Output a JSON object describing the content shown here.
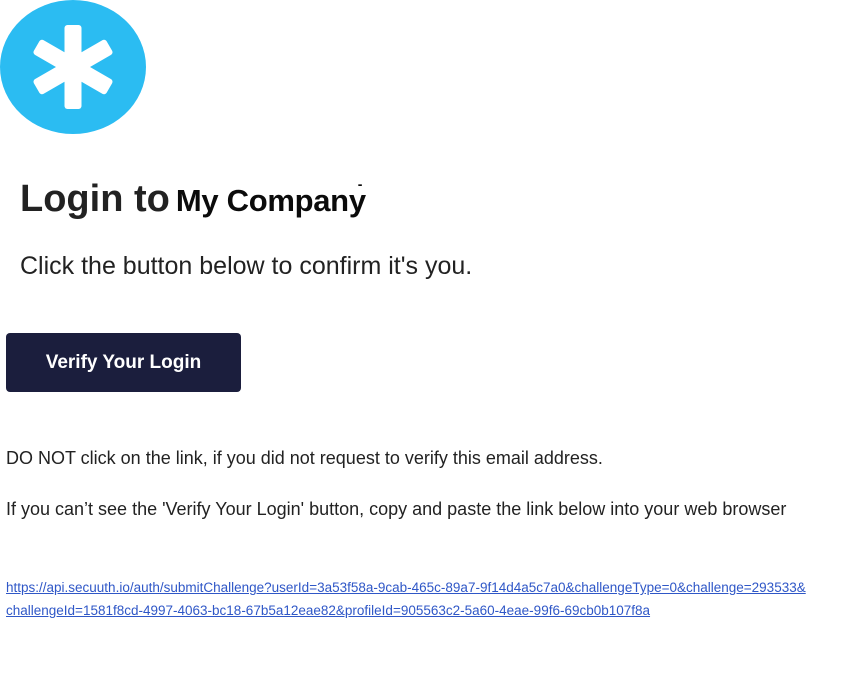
{
  "logo": {
    "icon": "asterisk-icon",
    "color": "#2bbcf2",
    "glyph_color": "#ffffff"
  },
  "heading": {
    "prefix": "Login to",
    "company": "My Company",
    "company_mark": "-"
  },
  "subtitle": "Click the button below to confirm it's you.",
  "button": {
    "label": "Verify Your Login",
    "background": "#1b1e3d",
    "text_color": "#ffffff"
  },
  "warning": "DO NOT click on the link, if you did not request to verify this email address.",
  "fallback_text": "If you can’t see the 'Verify Your Login' button, copy and paste the link below into your web browser",
  "verification_link": "https://api.secuuth.io/auth/submitChallenge?userId=3a53f58a-9cab-465c-89a7-9f14d4a5c7a0&challengeType=0&challenge=293533&challengeId=1581f8cd-4997-4063-bc18-67b5a12eae82&profileId=905563c2-5a60-4eae-99f6-69cb0b107f8a",
  "colors": {
    "link": "#2f57c7",
    "text": "#222222"
  }
}
